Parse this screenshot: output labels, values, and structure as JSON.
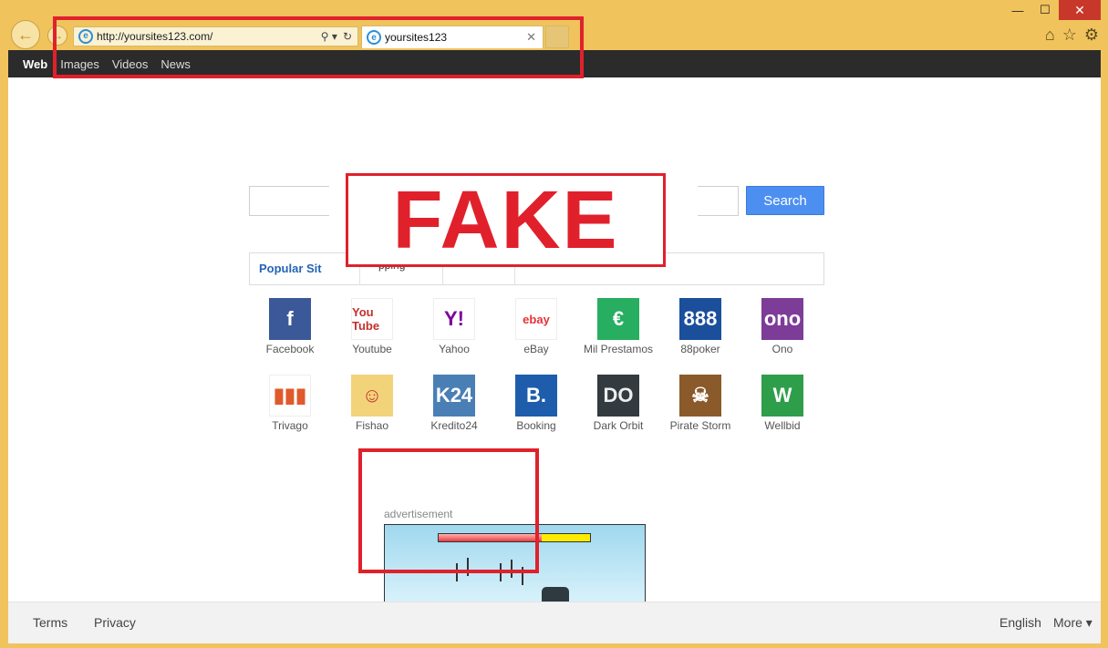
{
  "browser": {
    "address_url": "http://yoursites123.com/",
    "tab_title": "yoursites123",
    "window_controls": [
      "—",
      "☐",
      "✕"
    ],
    "tools_icons": [
      "home-icon",
      "star-icon",
      "gear-icon"
    ]
  },
  "topnav": {
    "items": [
      "Web",
      "Images",
      "Videos",
      "News"
    ]
  },
  "search": {
    "button_label": "Search"
  },
  "tabs": {
    "popular": "Popular Sit",
    "second": "pping"
  },
  "fake_label": "FAKE",
  "sites": [
    {
      "label": "Facebook",
      "glyph": "f",
      "bg": "#3b5998",
      "fg": "#fff"
    },
    {
      "label": "Youtube",
      "glyph": "You Tube",
      "bg": "#ffffff",
      "fg": "#c4302b"
    },
    {
      "label": "Yahoo",
      "glyph": "Y!",
      "bg": "#ffffff",
      "fg": "#7b0099"
    },
    {
      "label": "eBay",
      "glyph": "ebay",
      "bg": "#ffffff",
      "fg": "#e53238"
    },
    {
      "label": "Mil Prestamos",
      "glyph": "€",
      "bg": "#27ae60",
      "fg": "#fff"
    },
    {
      "label": "88poker",
      "glyph": "888",
      "bg": "#1b4f9c",
      "fg": "#fff"
    },
    {
      "label": "Ono",
      "glyph": "ono",
      "bg": "#7d3c98",
      "fg": "#fff"
    },
    {
      "label": "Trivago",
      "glyph": "▮▮▮",
      "bg": "#ffffff",
      "fg": "#e05a2b"
    },
    {
      "label": "Fishao",
      "glyph": "☺",
      "bg": "#f3d37a",
      "fg": "#c0392b"
    },
    {
      "label": "Kredito24",
      "glyph": "K24",
      "bg": "#4a7fb5",
      "fg": "#fff"
    },
    {
      "label": "Booking",
      "glyph": "B.",
      "bg": "#1e5dab",
      "fg": "#fff"
    },
    {
      "label": "Dark Orbit",
      "glyph": "DO",
      "bg": "#333a40",
      "fg": "#eee"
    },
    {
      "label": "Pirate Storm",
      "glyph": "☠",
      "bg": "#8a5a2b",
      "fg": "#fff"
    },
    {
      "label": "Wellbid",
      "glyph": "W",
      "bg": "#2e9e4a",
      "fg": "#fff"
    }
  ],
  "ad": {
    "label": "advertisement",
    "hp_fraction": 0.68
  },
  "footer": {
    "terms": "Terms",
    "privacy": "Privacy",
    "language": "English",
    "more": "More ▾"
  }
}
